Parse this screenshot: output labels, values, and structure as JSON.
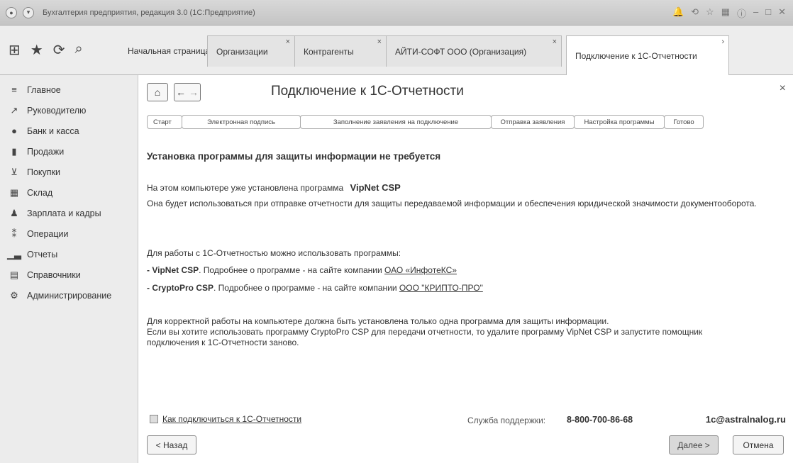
{
  "window": {
    "title": "Бухгалтерия предприятия, редакция 3.0  (1С:Предприятие)"
  },
  "tabs": [
    {
      "label": "Начальная страница"
    },
    {
      "label": "Организации"
    },
    {
      "label": "Контрагенты"
    },
    {
      "label": "АЙТИ-СОФТ ООО (Организация)"
    },
    {
      "label": "Подключение к 1С-Отчетности"
    }
  ],
  "sidebar": {
    "items": [
      {
        "label": "Главное",
        "icon": "menu-icon"
      },
      {
        "label": "Руководителю",
        "icon": "chart-trend-icon"
      },
      {
        "label": "Банк и касса",
        "icon": "coin-icon"
      },
      {
        "label": "Продажи",
        "icon": "bag-icon"
      },
      {
        "label": "Покупки",
        "icon": "cart-icon"
      },
      {
        "label": "Склад",
        "icon": "warehouse-icon"
      },
      {
        "label": "Зарплата и кадры",
        "icon": "person-icon"
      },
      {
        "label": "Операции",
        "icon": "operations-icon"
      },
      {
        "label": "Отчеты",
        "icon": "bar-chart-icon"
      },
      {
        "label": "Справочники",
        "icon": "book-icon"
      },
      {
        "label": "Администрирование",
        "icon": "gear-icon"
      }
    ]
  },
  "page": {
    "title": "Подключение к 1С-Отчетности",
    "steps": [
      {
        "label": "Старт"
      },
      {
        "label": "Электронная подпись"
      },
      {
        "label": "Заполнение заявления на подключение"
      },
      {
        "label": "Отправка заявления"
      },
      {
        "label": "Настройка программы"
      },
      {
        "label": "Готово"
      }
    ],
    "heading": "Установка программы для защиты информации не требуется",
    "installed_prefix": "На этом компьютере уже установлена программа",
    "installed_program": "VipNet CSP",
    "usage_text": "Она будет использоваться при отправке отчетности для защиты передаваемой информации и обеспечения юридической значимости документооборота.",
    "programs_intro": "Для работы с 1С-Отчетностью можно использовать программы:",
    "program1_name": "- VipNet CSP",
    "program1_text": ". Подробнее о программе - на сайте компании",
    "program1_link": "ОАО «ИнфотеКС»",
    "program2_name": "- CryptoPro CSP",
    "program2_text": ". Подробнее о программе - на сайте компании",
    "program2_link": "ООО \"КРИПТО-ПРО\"",
    "note_line1": "Для корректной работы на компьютере должна быть установлена только одна программа для защиты информации.",
    "note_line2": "Если вы хотите использовать программу CryptoPro CSP для передачи отчетности, то удалите программу VipNet CSP и запустите помощник",
    "note_line3": "подключения к 1С-Отчетности заново."
  },
  "footer": {
    "how_to_link": "Как подключиться к 1С-Отчетности",
    "support_label": "Служба поддержки:",
    "support_phone": "8-800-700-86-68",
    "support_email": "1c@astralnalog.ru",
    "back_label": "< Назад",
    "next_label": "Далее >",
    "cancel_label": "Отмена"
  }
}
